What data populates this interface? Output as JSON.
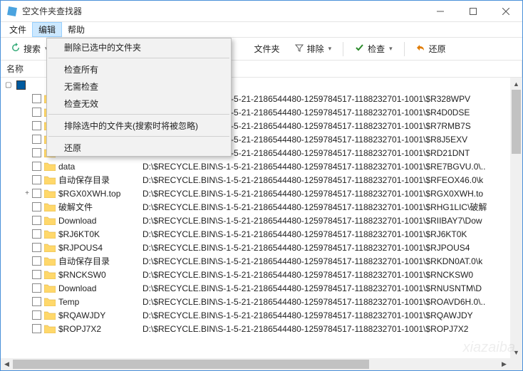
{
  "window": {
    "title": "空文件夹查找器"
  },
  "menubar": {
    "file": "文件",
    "edit": "编辑",
    "help": "帮助"
  },
  "toolbar": {
    "search": "搜索",
    "find_empty": "文件夹",
    "sort": "排除",
    "check": "检查",
    "restore": "还原"
  },
  "dropdown": {
    "delete_selected": "删除已选中的文件夹",
    "check_all": "检查所有",
    "uncheck_all": "无需检查",
    "check_invalid": "检查无效",
    "exclude_selected": "排除选中的文件夹(搜索时将被忽略)",
    "restore": "还原"
  },
  "columns": {
    "name": "名称"
  },
  "root": {
    "label": ""
  },
  "base_path": "D:\\$RECYCLE.BIN\\S-1-5-21-2186544480-1259784517-1188232701-1001\\",
  "rows": [
    {
      "name": "",
      "suffix": "$R328WPV",
      "exp": ""
    },
    {
      "name": "",
      "suffix": "$R4D0DSE",
      "exp": ""
    },
    {
      "name": "",
      "suffix": "$R7RMB7S",
      "exp": ""
    },
    {
      "name": "",
      "suffix": "$R8J5EXV",
      "exp": ""
    },
    {
      "name": "$RD21DNT",
      "suffix": "$RD21DNT",
      "exp": ""
    },
    {
      "name": "data",
      "suffix": "$RE7BGVU.0\\..",
      "exp": ""
    },
    {
      "name": "自动保存目录",
      "suffix": "$RFEOX46.0\\k",
      "exp": ""
    },
    {
      "name": "$RGX0XWH.top",
      "suffix": "$RGX0XWH.to",
      "exp": "+"
    },
    {
      "name": "破解文件",
      "suffix": "$RHG1LIC\\破解",
      "exp": ""
    },
    {
      "name": "Download",
      "suffix": "$RIIBAY7\\Dow",
      "exp": ""
    },
    {
      "name": "$RJ6KT0K",
      "suffix": "$RJ6KT0K",
      "exp": ""
    },
    {
      "name": "$RJPOUS4",
      "suffix": "$RJPOUS4",
      "exp": ""
    },
    {
      "name": "自动保存目录",
      "suffix": "$RKDN0AT.0\\k",
      "exp": ""
    },
    {
      "name": "$RNCKSW0",
      "suffix": "$RNCKSW0",
      "exp": ""
    },
    {
      "name": "Download",
      "suffix": "$RNUSNTM\\D",
      "exp": ""
    },
    {
      "name": "Temp",
      "suffix": "$ROAVD6H.0\\..",
      "exp": ""
    },
    {
      "name": "$RQAWJDY",
      "suffix": "$RQAWJDY",
      "exp": ""
    },
    {
      "name": "$ROPJ7X2",
      "suffix": "$ROPJ7X2",
      "exp": ""
    }
  ]
}
